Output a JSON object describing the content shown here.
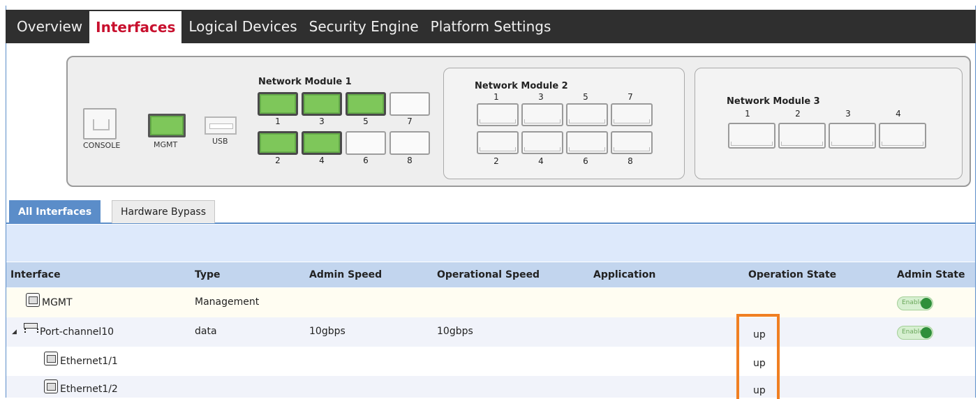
{
  "nav": {
    "tabs": [
      "Overview",
      "Interfaces",
      "Logical Devices",
      "Security Engine",
      "Platform Settings"
    ],
    "active": "Interfaces"
  },
  "chassis": {
    "console_label": "CONSOLE",
    "mgmt_label": "MGMT",
    "usb_label": "USB",
    "nm1": {
      "title": "Network Module 1",
      "top_ports": [
        "1",
        "3",
        "5",
        "7"
      ],
      "bottom_ports": [
        "2",
        "4",
        "6",
        "8"
      ]
    },
    "nm2": {
      "title": "Network Module 2",
      "top_ports": [
        "1",
        "3",
        "5",
        "7"
      ],
      "bottom_ports": [
        "2",
        "4",
        "6",
        "8"
      ]
    },
    "nm3": {
      "title": "Network Module 3",
      "ports": [
        "1",
        "2",
        "3",
        "4"
      ]
    },
    "port_status_colors": {
      "up": "#7ec75a",
      "down": "#fafafa"
    }
  },
  "subtabs": {
    "all": "All Interfaces",
    "bypass": "Hardware Bypass"
  },
  "table": {
    "headers": {
      "interface": "Interface",
      "type": "Type",
      "admin_speed": "Admin Speed",
      "operational_speed": "Operational Speed",
      "application": "Application",
      "operation_state": "Operation State",
      "admin_state": "Admin State"
    },
    "rows": [
      {
        "interface": "MGMT",
        "type": "Management",
        "admin_speed": "",
        "operational_speed": "",
        "application": "",
        "operation_state": "",
        "admin_state": "Enabled"
      },
      {
        "interface": "Port-channel10",
        "type": "data",
        "admin_speed": "10gbps",
        "operational_speed": "10gbps",
        "application": "",
        "operation_state": "up",
        "admin_state": "Enabled"
      },
      {
        "interface": "Ethernet1/1",
        "type": "",
        "admin_speed": "",
        "operational_speed": "",
        "application": "",
        "operation_state": "up",
        "admin_state": ""
      },
      {
        "interface": "Ethernet1/2",
        "type": "",
        "admin_speed": "",
        "operational_speed": "",
        "application": "",
        "operation_state": "up",
        "admin_state": ""
      }
    ]
  },
  "colors": {
    "accent": "#c8102e",
    "tab_blue": "#5b8dc9",
    "highlight": "#f07f22",
    "enabled_green": "#2f8f3a"
  }
}
